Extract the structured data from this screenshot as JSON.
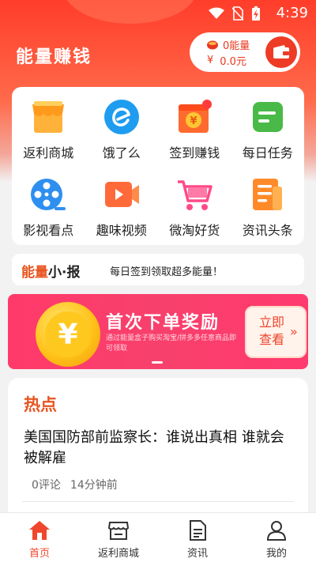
{
  "status_bar": {
    "time": "4:39"
  },
  "header": {
    "title": "能量赚钱"
  },
  "wallet": {
    "energy_label": "0能量",
    "currency_symbol": "¥",
    "money": "0.0元"
  },
  "grid": [
    {
      "label": "返利商城",
      "icon": "store-icon"
    },
    {
      "label": "饿了么",
      "icon": "eleme-icon"
    },
    {
      "label": "签到赚钱",
      "icon": "checkin-icon"
    },
    {
      "label": "每日任务",
      "icon": "task-icon"
    },
    {
      "label": "影视看点",
      "icon": "film-reel-icon"
    },
    {
      "label": "趣味视频",
      "icon": "video-play-icon"
    },
    {
      "label": "微淘好货",
      "icon": "shopping-cart-icon"
    },
    {
      "label": "资讯头条",
      "icon": "newspaper-icon"
    }
  ],
  "news_bar": {
    "brand_part1": "能量",
    "brand_part2": "小·报",
    "message": "每日签到领取超多能量！"
  },
  "banner": {
    "title": "首次下单奖励",
    "subtitle": "通过能量盒子购买淘宝/拼多多任意商品即可领取",
    "cta": "立即查看",
    "coin_symbol": "¥"
  },
  "hot": {
    "title": "热点",
    "headline": "美国国防部前监察长：谁说出真相 谁就会被解雇",
    "comments": "0评论",
    "time": "14分钟前"
  },
  "tabs": [
    {
      "label": "首页",
      "icon": "home-icon",
      "active": true
    },
    {
      "label": "返利商城",
      "icon": "store-icon",
      "active": false
    },
    {
      "label": "资讯",
      "icon": "document-icon",
      "active": false
    },
    {
      "label": "我的",
      "icon": "user-icon",
      "active": false
    }
  ],
  "colors": {
    "accent": "#f0462d",
    "header_red": "#ff3d2a",
    "banner_pink": "#f8406c"
  }
}
